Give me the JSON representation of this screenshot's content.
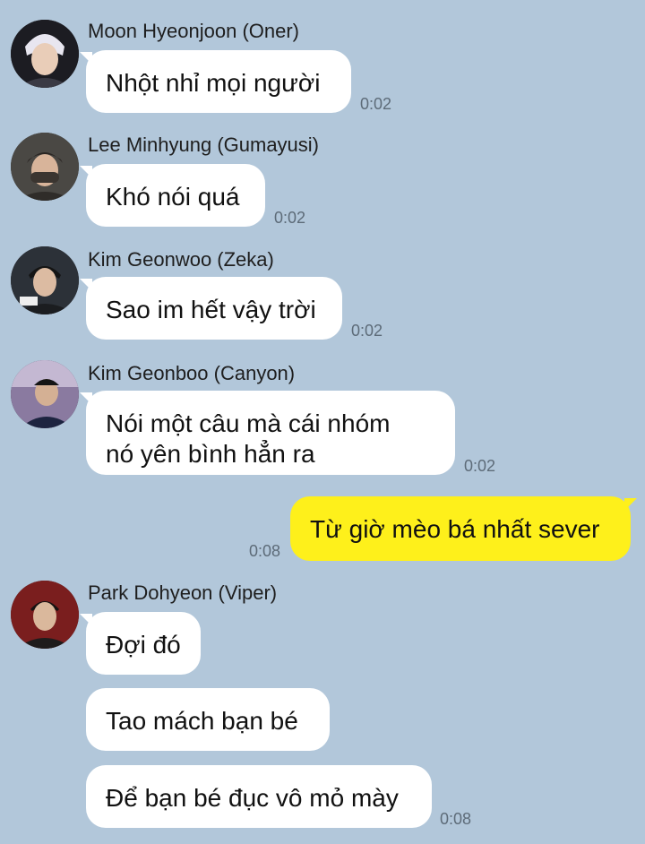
{
  "messages": [
    {
      "sender": "Moon Hyeonjoon (Oner)",
      "text": "Nhột nhỉ mọi người",
      "time": "0:02"
    },
    {
      "sender": "Lee Minhyung (Gumayusi)",
      "text": "Khó nói quá",
      "time": "0:02"
    },
    {
      "sender": "Kim Geonwoo (Zeka)",
      "text": "Sao im hết vậy trời",
      "time": "0:02"
    },
    {
      "sender": "Kim Geonboo (Canyon)",
      "lines": [
        "Nói một câu mà cái nhóm",
        "nó yên bình hẳn ra"
      ],
      "time": "0:02"
    },
    {
      "sender": "me",
      "text": "Từ giờ mèo bá nhất sever",
      "time": "0:08"
    },
    {
      "sender": "Park Dohyeon (Viper)",
      "texts": [
        "Đợi đó",
        "Tao mách bạn bé",
        "Để bạn bé đục vô mỏ mày"
      ],
      "time": "0:08"
    }
  ],
  "colors": {
    "background": "#b2c7da",
    "incoming_bubble": "#ffffff",
    "outgoing_bubble": "#fef01b",
    "timestamp": "#5d6b78"
  },
  "icons": [
    "avatar-oner",
    "avatar-gumayusi",
    "avatar-zeka",
    "avatar-canyon",
    "avatar-viper"
  ]
}
